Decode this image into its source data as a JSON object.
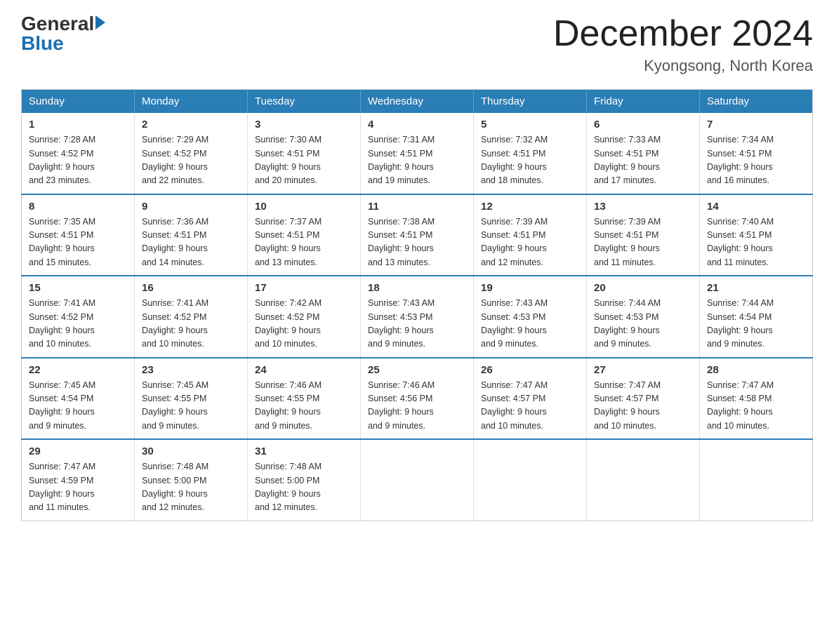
{
  "header": {
    "logo_general": "General",
    "logo_blue": "Blue",
    "month_title": "December 2024",
    "location": "Kyongsong, North Korea"
  },
  "weekdays": [
    "Sunday",
    "Monday",
    "Tuesday",
    "Wednesday",
    "Thursday",
    "Friday",
    "Saturday"
  ],
  "weeks": [
    [
      {
        "day": "1",
        "sunrise": "7:28 AM",
        "sunset": "4:52 PM",
        "daylight": "9 hours and 23 minutes."
      },
      {
        "day": "2",
        "sunrise": "7:29 AM",
        "sunset": "4:52 PM",
        "daylight": "9 hours and 22 minutes."
      },
      {
        "day": "3",
        "sunrise": "7:30 AM",
        "sunset": "4:51 PM",
        "daylight": "9 hours and 20 minutes."
      },
      {
        "day": "4",
        "sunrise": "7:31 AM",
        "sunset": "4:51 PM",
        "daylight": "9 hours and 19 minutes."
      },
      {
        "day": "5",
        "sunrise": "7:32 AM",
        "sunset": "4:51 PM",
        "daylight": "9 hours and 18 minutes."
      },
      {
        "day": "6",
        "sunrise": "7:33 AM",
        "sunset": "4:51 PM",
        "daylight": "9 hours and 17 minutes."
      },
      {
        "day": "7",
        "sunrise": "7:34 AM",
        "sunset": "4:51 PM",
        "daylight": "9 hours and 16 minutes."
      }
    ],
    [
      {
        "day": "8",
        "sunrise": "7:35 AM",
        "sunset": "4:51 PM",
        "daylight": "9 hours and 15 minutes."
      },
      {
        "day": "9",
        "sunrise": "7:36 AM",
        "sunset": "4:51 PM",
        "daylight": "9 hours and 14 minutes."
      },
      {
        "day": "10",
        "sunrise": "7:37 AM",
        "sunset": "4:51 PM",
        "daylight": "9 hours and 13 minutes."
      },
      {
        "day": "11",
        "sunrise": "7:38 AM",
        "sunset": "4:51 PM",
        "daylight": "9 hours and 13 minutes."
      },
      {
        "day": "12",
        "sunrise": "7:39 AM",
        "sunset": "4:51 PM",
        "daylight": "9 hours and 12 minutes."
      },
      {
        "day": "13",
        "sunrise": "7:39 AM",
        "sunset": "4:51 PM",
        "daylight": "9 hours and 11 minutes."
      },
      {
        "day": "14",
        "sunrise": "7:40 AM",
        "sunset": "4:51 PM",
        "daylight": "9 hours and 11 minutes."
      }
    ],
    [
      {
        "day": "15",
        "sunrise": "7:41 AM",
        "sunset": "4:52 PM",
        "daylight": "9 hours and 10 minutes."
      },
      {
        "day": "16",
        "sunrise": "7:41 AM",
        "sunset": "4:52 PM",
        "daylight": "9 hours and 10 minutes."
      },
      {
        "day": "17",
        "sunrise": "7:42 AM",
        "sunset": "4:52 PM",
        "daylight": "9 hours and 10 minutes."
      },
      {
        "day": "18",
        "sunrise": "7:43 AM",
        "sunset": "4:53 PM",
        "daylight": "9 hours and 9 minutes."
      },
      {
        "day": "19",
        "sunrise": "7:43 AM",
        "sunset": "4:53 PM",
        "daylight": "9 hours and 9 minutes."
      },
      {
        "day": "20",
        "sunrise": "7:44 AM",
        "sunset": "4:53 PM",
        "daylight": "9 hours and 9 minutes."
      },
      {
        "day": "21",
        "sunrise": "7:44 AM",
        "sunset": "4:54 PM",
        "daylight": "9 hours and 9 minutes."
      }
    ],
    [
      {
        "day": "22",
        "sunrise": "7:45 AM",
        "sunset": "4:54 PM",
        "daylight": "9 hours and 9 minutes."
      },
      {
        "day": "23",
        "sunrise": "7:45 AM",
        "sunset": "4:55 PM",
        "daylight": "9 hours and 9 minutes."
      },
      {
        "day": "24",
        "sunrise": "7:46 AM",
        "sunset": "4:55 PM",
        "daylight": "9 hours and 9 minutes."
      },
      {
        "day": "25",
        "sunrise": "7:46 AM",
        "sunset": "4:56 PM",
        "daylight": "9 hours and 9 minutes."
      },
      {
        "day": "26",
        "sunrise": "7:47 AM",
        "sunset": "4:57 PM",
        "daylight": "9 hours and 10 minutes."
      },
      {
        "day": "27",
        "sunrise": "7:47 AM",
        "sunset": "4:57 PM",
        "daylight": "9 hours and 10 minutes."
      },
      {
        "day": "28",
        "sunrise": "7:47 AM",
        "sunset": "4:58 PM",
        "daylight": "9 hours and 10 minutes."
      }
    ],
    [
      {
        "day": "29",
        "sunrise": "7:47 AM",
        "sunset": "4:59 PM",
        "daylight": "9 hours and 11 minutes."
      },
      {
        "day": "30",
        "sunrise": "7:48 AM",
        "sunset": "5:00 PM",
        "daylight": "9 hours and 12 minutes."
      },
      {
        "day": "31",
        "sunrise": "7:48 AM",
        "sunset": "5:00 PM",
        "daylight": "9 hours and 12 minutes."
      },
      null,
      null,
      null,
      null
    ]
  ],
  "labels": {
    "sunrise_prefix": "Sunrise: ",
    "sunset_prefix": "Sunset: ",
    "daylight_prefix": "Daylight: "
  }
}
